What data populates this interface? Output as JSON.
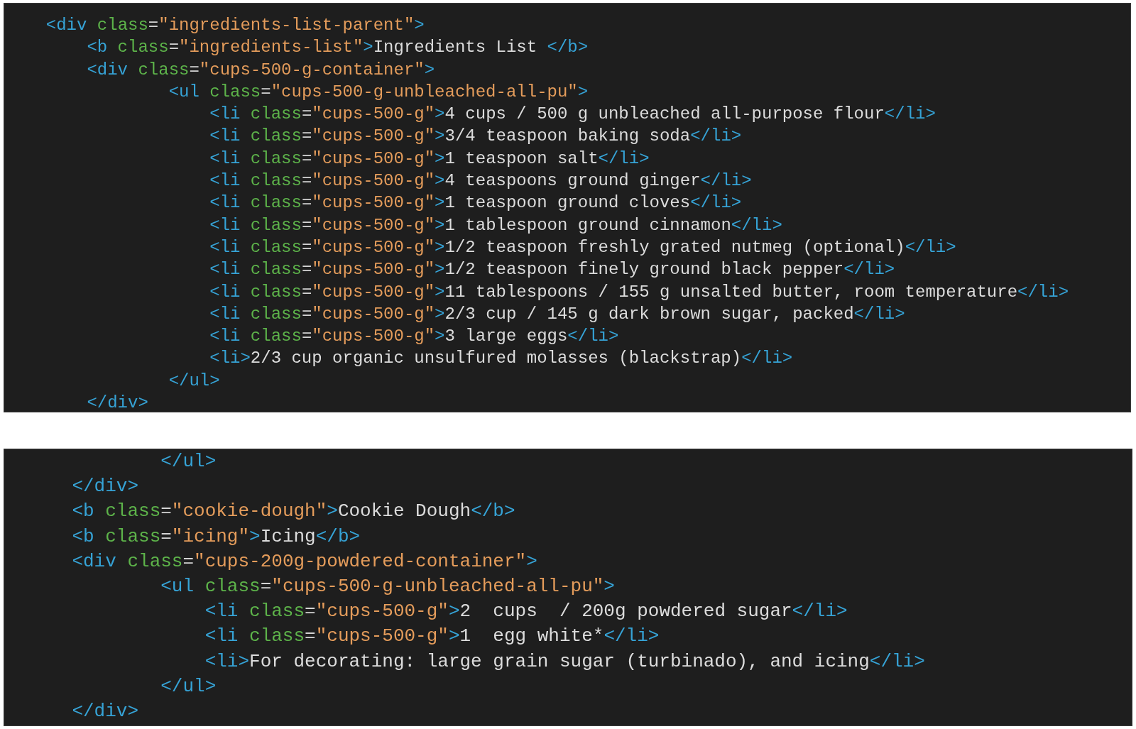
{
  "code_panels": [
    {
      "lines": [
        {
          "tokens": [
            {
              "kind": "tag",
              "text": "  <div"
            },
            {
              "kind": "attr",
              "text": " class"
            },
            {
              "kind": "punct",
              "text": "="
            },
            {
              "kind": "string",
              "text": "\"ingredients-list-parent\""
            },
            {
              "kind": "tag",
              "text": ">"
            }
          ]
        },
        {
          "tokens": [
            {
              "kind": "tag",
              "text": "      <b"
            },
            {
              "kind": "attr",
              "text": " class"
            },
            {
              "kind": "punct",
              "text": "="
            },
            {
              "kind": "string",
              "text": "\"ingredients-list\""
            },
            {
              "kind": "tag",
              "text": ">"
            },
            {
              "kind": "text",
              "text": "Ingredients List "
            },
            {
              "kind": "tag",
              "text": "</b>"
            }
          ]
        },
        {
          "tokens": [
            {
              "kind": "tag",
              "text": "      <div"
            },
            {
              "kind": "attr",
              "text": " class"
            },
            {
              "kind": "punct",
              "text": "="
            },
            {
              "kind": "string",
              "text": "\"cups-500-g-container\""
            },
            {
              "kind": "tag",
              "text": ">"
            }
          ]
        },
        {
          "tokens": [
            {
              "kind": "tag",
              "text": "              <ul"
            },
            {
              "kind": "attr",
              "text": " class"
            },
            {
              "kind": "punct",
              "text": "="
            },
            {
              "kind": "string",
              "text": "\"cups-500-g-unbleached-all-pu\""
            },
            {
              "kind": "tag",
              "text": ">"
            }
          ]
        },
        {
          "tokens": [
            {
              "kind": "tag",
              "text": "                  <li"
            },
            {
              "kind": "attr",
              "text": " class"
            },
            {
              "kind": "punct",
              "text": "="
            },
            {
              "kind": "string",
              "text": "\"cups-500-g\""
            },
            {
              "kind": "tag",
              "text": ">"
            },
            {
              "kind": "text",
              "text": "4 cups / 500 g unbleached all-purpose flour"
            },
            {
              "kind": "tag",
              "text": "</li>"
            }
          ]
        },
        {
          "tokens": [
            {
              "kind": "tag",
              "text": "                  <li"
            },
            {
              "kind": "attr",
              "text": " class"
            },
            {
              "kind": "punct",
              "text": "="
            },
            {
              "kind": "string",
              "text": "\"cups-500-g\""
            },
            {
              "kind": "tag",
              "text": ">"
            },
            {
              "kind": "text",
              "text": "3/4 teaspoon baking soda"
            },
            {
              "kind": "tag",
              "text": "</li>"
            }
          ]
        },
        {
          "tokens": [
            {
              "kind": "tag",
              "text": "                  <li"
            },
            {
              "kind": "attr",
              "text": " class"
            },
            {
              "kind": "punct",
              "text": "="
            },
            {
              "kind": "string",
              "text": "\"cups-500-g\""
            },
            {
              "kind": "tag",
              "text": ">"
            },
            {
              "kind": "text",
              "text": "1 teaspoon salt"
            },
            {
              "kind": "tag",
              "text": "</li>"
            }
          ]
        },
        {
          "tokens": [
            {
              "kind": "tag",
              "text": "                  <li"
            },
            {
              "kind": "attr",
              "text": " class"
            },
            {
              "kind": "punct",
              "text": "="
            },
            {
              "kind": "string",
              "text": "\"cups-500-g\""
            },
            {
              "kind": "tag",
              "text": ">"
            },
            {
              "kind": "text",
              "text": "4 teaspoons ground ginger"
            },
            {
              "kind": "tag",
              "text": "</li>"
            }
          ]
        },
        {
          "tokens": [
            {
              "kind": "tag",
              "text": "                  <li"
            },
            {
              "kind": "attr",
              "text": " class"
            },
            {
              "kind": "punct",
              "text": "="
            },
            {
              "kind": "string",
              "text": "\"cups-500-g\""
            },
            {
              "kind": "tag",
              "text": ">"
            },
            {
              "kind": "text",
              "text": "1 teaspoon ground cloves"
            },
            {
              "kind": "tag",
              "text": "</li>"
            }
          ]
        },
        {
          "tokens": [
            {
              "kind": "tag",
              "text": "                  <li"
            },
            {
              "kind": "attr",
              "text": " class"
            },
            {
              "kind": "punct",
              "text": "="
            },
            {
              "kind": "string",
              "text": "\"cups-500-g\""
            },
            {
              "kind": "tag",
              "text": ">"
            },
            {
              "kind": "text",
              "text": "1 tablespoon ground cinnamon"
            },
            {
              "kind": "tag",
              "text": "</li>"
            }
          ]
        },
        {
          "tokens": [
            {
              "kind": "tag",
              "text": "                  <li"
            },
            {
              "kind": "attr",
              "text": " class"
            },
            {
              "kind": "punct",
              "text": "="
            },
            {
              "kind": "string",
              "text": "\"cups-500-g\""
            },
            {
              "kind": "tag",
              "text": ">"
            },
            {
              "kind": "text",
              "text": "1/2 teaspoon freshly grated nutmeg (optional)"
            },
            {
              "kind": "tag",
              "text": "</li>"
            }
          ]
        },
        {
          "tokens": [
            {
              "kind": "tag",
              "text": "                  <li"
            },
            {
              "kind": "attr",
              "text": " class"
            },
            {
              "kind": "punct",
              "text": "="
            },
            {
              "kind": "string",
              "text": "\"cups-500-g\""
            },
            {
              "kind": "tag",
              "text": ">"
            },
            {
              "kind": "text",
              "text": "1/2 teaspoon finely ground black pepper"
            },
            {
              "kind": "tag",
              "text": "</li>"
            }
          ]
        },
        {
          "tokens": [
            {
              "kind": "tag",
              "text": "                  <li"
            },
            {
              "kind": "attr",
              "text": " class"
            },
            {
              "kind": "punct",
              "text": "="
            },
            {
              "kind": "string",
              "text": "\"cups-500-g\""
            },
            {
              "kind": "tag",
              "text": ">"
            },
            {
              "kind": "text",
              "text": "11 tablespoons / 155 g unsalted butter, room temperature"
            },
            {
              "kind": "tag",
              "text": "</li>"
            }
          ]
        },
        {
          "tokens": [
            {
              "kind": "tag",
              "text": "                  <li"
            },
            {
              "kind": "attr",
              "text": " class"
            },
            {
              "kind": "punct",
              "text": "="
            },
            {
              "kind": "string",
              "text": "\"cups-500-g\""
            },
            {
              "kind": "tag",
              "text": ">"
            },
            {
              "kind": "text",
              "text": "2/3 cup / 145 g dark brown sugar, packed"
            },
            {
              "kind": "tag",
              "text": "</li>"
            }
          ]
        },
        {
          "tokens": [
            {
              "kind": "tag",
              "text": "                  <li"
            },
            {
              "kind": "attr",
              "text": " class"
            },
            {
              "kind": "punct",
              "text": "="
            },
            {
              "kind": "string",
              "text": "\"cups-500-g\""
            },
            {
              "kind": "tag",
              "text": ">"
            },
            {
              "kind": "text",
              "text": "3 large eggs"
            },
            {
              "kind": "tag",
              "text": "</li>"
            }
          ]
        },
        {
          "tokens": [
            {
              "kind": "tag",
              "text": "                  <li>"
            },
            {
              "kind": "text",
              "text": "2/3 cup organic unsulfured molasses (blackstrap)"
            },
            {
              "kind": "tag",
              "text": "</li>"
            }
          ]
        },
        {
          "tokens": [
            {
              "kind": "tag",
              "text": "              </ul>"
            }
          ]
        },
        {
          "tokens": [
            {
              "kind": "tag",
              "text": "      </div>"
            }
          ]
        }
      ]
    },
    {
      "lines": [
        {
          "tokens": [
            {
              "kind": "tag",
              "text": "            </ul>"
            }
          ]
        },
        {
          "tokens": [
            {
              "kind": "tag",
              "text": "    </div>"
            }
          ]
        },
        {
          "tokens": [
            {
              "kind": "tag",
              "text": "    <b"
            },
            {
              "kind": "attr",
              "text": " class"
            },
            {
              "kind": "punct",
              "text": "="
            },
            {
              "kind": "string",
              "text": "\"cookie-dough\""
            },
            {
              "kind": "tag",
              "text": ">"
            },
            {
              "kind": "text",
              "text": "Cookie Dough"
            },
            {
              "kind": "tag",
              "text": "</b>"
            }
          ]
        },
        {
          "tokens": [
            {
              "kind": "tag",
              "text": "    <b"
            },
            {
              "kind": "attr",
              "text": " class"
            },
            {
              "kind": "punct",
              "text": "="
            },
            {
              "kind": "string",
              "text": "\"icing\""
            },
            {
              "kind": "tag",
              "text": ">"
            },
            {
              "kind": "text",
              "text": "Icing"
            },
            {
              "kind": "tag",
              "text": "</b>"
            }
          ]
        },
        {
          "tokens": [
            {
              "kind": "tag",
              "text": "    <div"
            },
            {
              "kind": "attr",
              "text": " class"
            },
            {
              "kind": "punct",
              "text": "="
            },
            {
              "kind": "string",
              "text": "\"cups-200g-powdered-container\""
            },
            {
              "kind": "tag",
              "text": ">"
            }
          ]
        },
        {
          "tokens": [
            {
              "kind": "tag",
              "text": "            <ul"
            },
            {
              "kind": "attr",
              "text": " class"
            },
            {
              "kind": "punct",
              "text": "="
            },
            {
              "kind": "string",
              "text": "\"cups-500-g-unbleached-all-pu\""
            },
            {
              "kind": "tag",
              "text": ">"
            }
          ]
        },
        {
          "tokens": [
            {
              "kind": "tag",
              "text": "                <li"
            },
            {
              "kind": "attr",
              "text": " class"
            },
            {
              "kind": "punct",
              "text": "="
            },
            {
              "kind": "string",
              "text": "\"cups-500-g\""
            },
            {
              "kind": "tag",
              "text": ">"
            },
            {
              "kind": "text",
              "text": "2  cups  / 200g powdered sugar"
            },
            {
              "kind": "tag",
              "text": "</li>"
            }
          ]
        },
        {
          "tokens": [
            {
              "kind": "tag",
              "text": "                <li"
            },
            {
              "kind": "attr",
              "text": " class"
            },
            {
              "kind": "punct",
              "text": "="
            },
            {
              "kind": "string",
              "text": "\"cups-500-g\""
            },
            {
              "kind": "tag",
              "text": ">"
            },
            {
              "kind": "text",
              "text": "1  egg white*"
            },
            {
              "kind": "tag",
              "text": "</li>"
            }
          ]
        },
        {
          "tokens": [
            {
              "kind": "tag",
              "text": "                <li>"
            },
            {
              "kind": "text",
              "text": "For decorating: large grain sugar (turbinado), and icing"
            },
            {
              "kind": "tag",
              "text": "</li>"
            }
          ]
        },
        {
          "tokens": [
            {
              "kind": "tag",
              "text": "            </ul>"
            }
          ]
        },
        {
          "tokens": [
            {
              "kind": "tag",
              "text": "    </div>"
            }
          ]
        }
      ]
    }
  ]
}
